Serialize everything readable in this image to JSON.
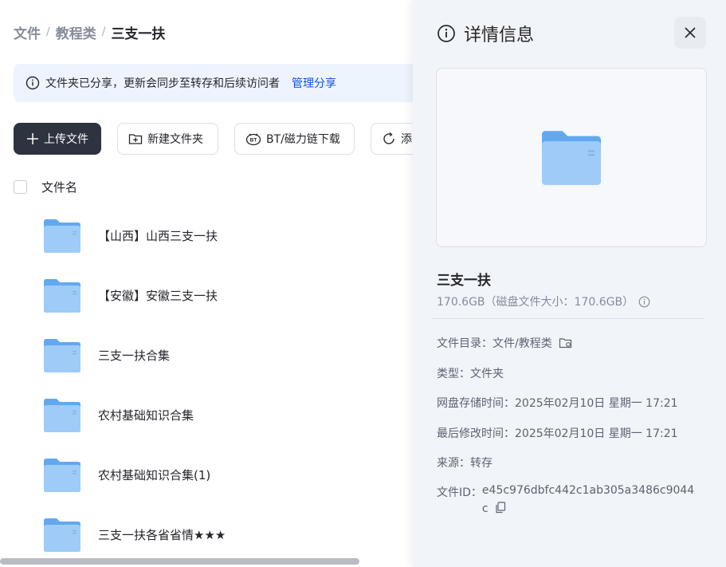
{
  "breadcrumb": {
    "items": [
      "文件",
      "教程类"
    ],
    "separator": "/",
    "current": "三支一扶"
  },
  "notice": {
    "text": "文件夹已分享，更新会同步至转存和后续访问者",
    "link": "管理分享"
  },
  "toolbar": {
    "upload": "上传文件",
    "new_folder": "新建文件夹",
    "bt": "BT/磁力链下载",
    "add": "添"
  },
  "list": {
    "header": "文件名",
    "files": [
      {
        "name": "【山西】山西三支一扶"
      },
      {
        "name": "【安徽】安徽三支一扶"
      },
      {
        "name": "三支一扶合集"
      },
      {
        "name": "农村基础知识合集"
      },
      {
        "name": "农村基础知识合集(1)"
      },
      {
        "name": "三支一扶各省省情★★★"
      }
    ]
  },
  "panel": {
    "title": "详情信息",
    "file_name": "三支一扶",
    "size": "170.6GB（磁盘文件大小：170.6GB）",
    "dir_label": "文件目录：",
    "dir_value": "文件/教程类",
    "type_label": "类型：",
    "type_value": "文件夹",
    "stored_label": "网盘存储时间：",
    "stored_value": "2025年02月10日 星期一 17:21",
    "modified_label": "最后修改时间：",
    "modified_value": "2025年02月10日 星期一 17:21",
    "source_label": "来源：",
    "source_value": "转存",
    "id_label": "文件ID：",
    "id_value": "e45c976dbfc442c1ab305a3486c9044c"
  },
  "colors": {
    "primary_button": "#2e3340",
    "link": "#0d53de",
    "folder": "#7fb8f3",
    "panel_bg": "#f1f4f8",
    "notice_bg": "#eef4fd"
  },
  "icons": [
    "info-icon",
    "plus-icon",
    "new-folder-icon",
    "bt-icon",
    "refresh-icon",
    "folder-icon",
    "close-icon",
    "folder-link-icon",
    "copy-icon"
  ]
}
